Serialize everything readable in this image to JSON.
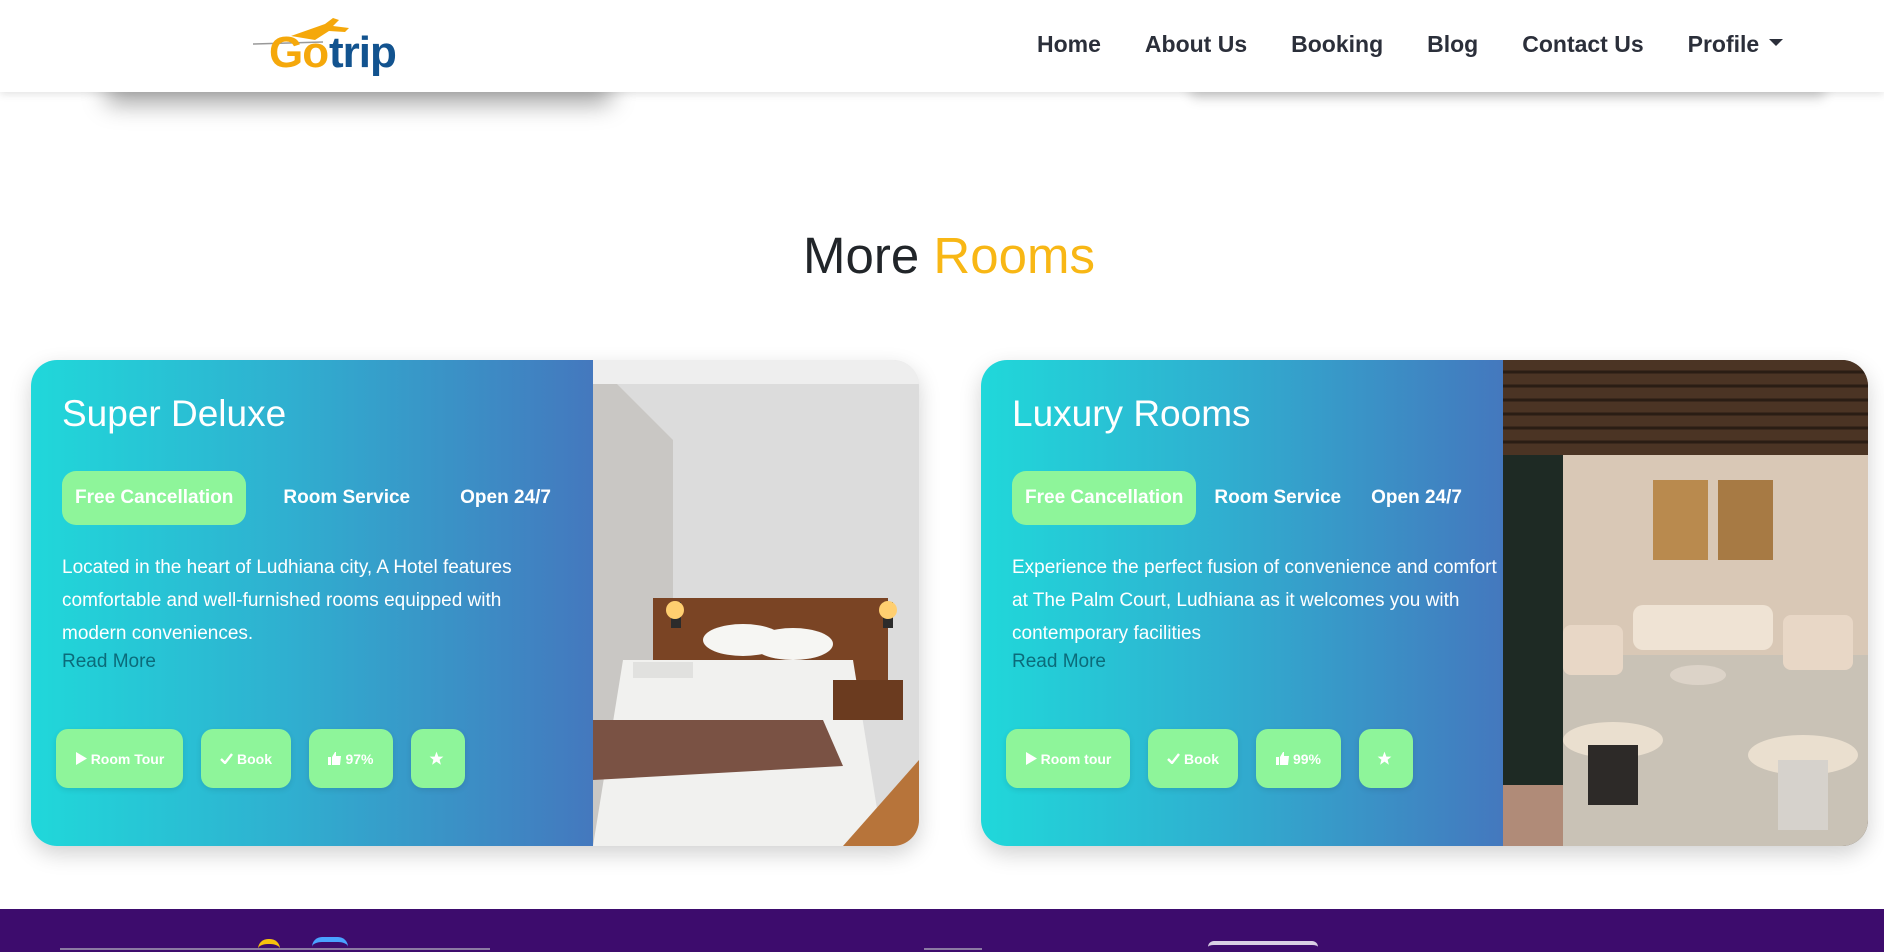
{
  "nav": {
    "logo_go": "Go",
    "logo_trip": "trip",
    "links": [
      "Home",
      "About Us",
      "Booking",
      "Blog",
      "Contact Us",
      "Profile"
    ]
  },
  "section": {
    "title_main": "More",
    "title_accent": "Rooms"
  },
  "rooms": [
    {
      "title": "Super Deluxe",
      "tags": [
        "Free Cancellation",
        "Room Service",
        "Open 24/7"
      ],
      "description": "Located in the heart of Ludhiana city, A Hotel features comfortable and well-furnished rooms equipped with modern conveniences.",
      "read_more": "Read More",
      "buttons": {
        "tour": "Room Tour",
        "book": "Book",
        "rating": "97%"
      }
    },
    {
      "title": "Luxury Rooms",
      "tags": [
        "Free Cancellation",
        "Room Service",
        "Open 24/7"
      ],
      "description": "Experience the perfect fusion of convenience and comfort at The Palm Court, Ludhiana as it welcomes you with contemporary facilities",
      "read_more": "Read More",
      "buttons": {
        "tour": "Room tour",
        "book": "Book",
        "rating": "99%"
      }
    }
  ],
  "colors": {
    "accent": "#f8b715",
    "pill": "#8ef59a",
    "gradient_start": "#20d8da",
    "gradient_end": "#4478be",
    "footer": "#3d0c6d"
  }
}
